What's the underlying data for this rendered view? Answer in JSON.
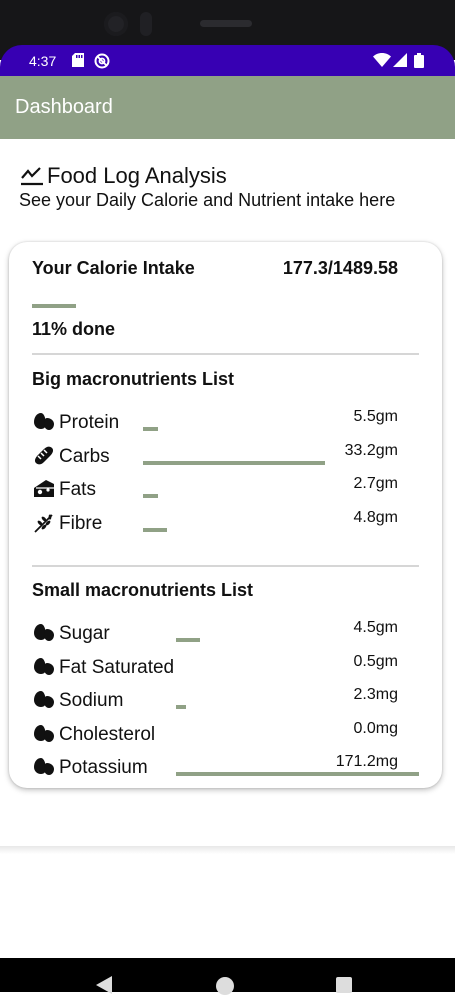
{
  "status_bar": {
    "time": "4:37"
  },
  "app_bar": {
    "title": "Dashboard"
  },
  "header": {
    "title": "Food Log Analysis",
    "subtitle": "See your Daily Calorie and Nutrient intake here"
  },
  "calories": {
    "label": "Your Calorie Intake",
    "value": "177.3/1489.58",
    "progress_fraction": 0.11,
    "done_text": "11% done"
  },
  "big_macros": {
    "title": "Big macronutrients List",
    "items": [
      {
        "name": "Protein",
        "value": "5.5gm",
        "icon": "egg-icon",
        "progress": 0.06
      },
      {
        "name": "Carbs",
        "value": "33.2gm",
        "icon": "bread-icon",
        "progress": 0.75
      },
      {
        "name": "Fats",
        "value": "2.7gm",
        "icon": "cheese-icon",
        "progress": 0.06
      },
      {
        "name": "Fibre",
        "value": "4.8gm",
        "icon": "grain-icon",
        "progress": 0.1
      }
    ]
  },
  "small_macros": {
    "title": "Small macronutrients List",
    "items": [
      {
        "name": "Sugar",
        "value": "4.5gm",
        "icon": "egg-icon",
        "progress": 0.1
      },
      {
        "name": "Fat Saturated",
        "value": "0.5gm",
        "icon": "egg-icon",
        "progress": 0.0
      },
      {
        "name": "Sodium",
        "value": "2.3mg",
        "icon": "egg-icon",
        "progress": 0.04
      },
      {
        "name": "Cholesterol",
        "value": "0.0mg",
        "icon": "egg-icon",
        "progress": 0.0
      },
      {
        "name": "Potassium",
        "value": "171.2mg",
        "icon": "egg-icon",
        "progress": 1.0
      }
    ]
  },
  "colors": {
    "accent": "#90a186",
    "status_bar": "#3700b3"
  }
}
